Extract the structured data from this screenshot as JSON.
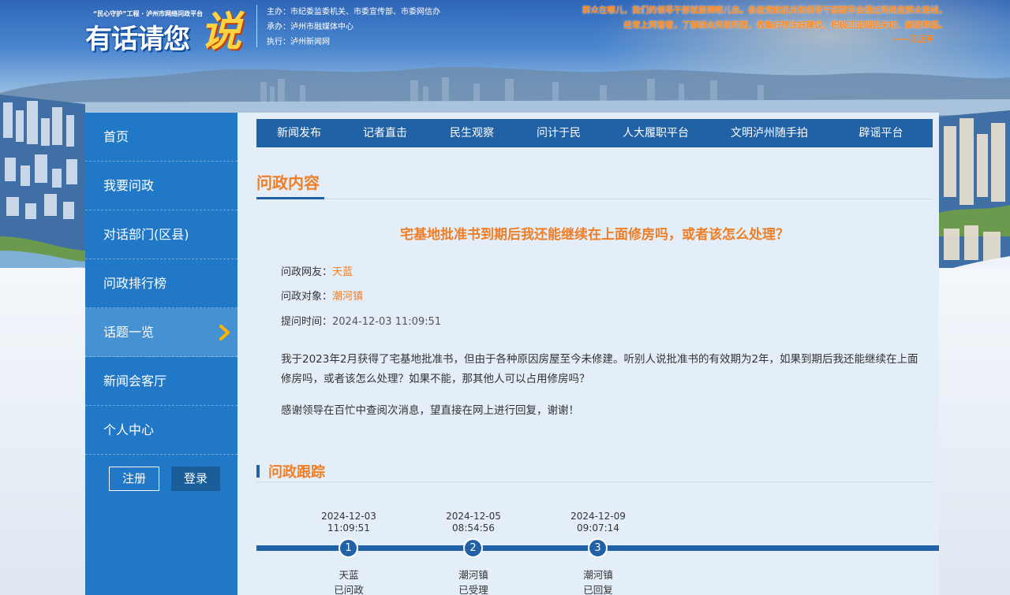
{
  "header": {
    "logo_sub": "“民心守护”工程 · 泸州市网络问政平台",
    "logo_main": "有话请您",
    "logo_accent": "说",
    "sponsor_lines": [
      "主办：市纪委监委机关、市委宣传部、市委网信办",
      "承办：泸州市融媒体中心",
      "执行：泸州新闻网"
    ],
    "quote_lines": [
      "群众在哪儿，我们的领导干部就要到哪儿去。各级党政机关和领导干部要学会通过网络走群众路线，",
      "经常上网看看，了解群众所思所愿，收集好想法好建议，积极回应网民关切、解疑释惑。"
    ],
    "quote_author": "——习近平"
  },
  "sidebar": {
    "items": [
      {
        "label": "首页"
      },
      {
        "label": "我要问政"
      },
      {
        "label": "对话部门(区县)"
      },
      {
        "label": "问政排行榜"
      },
      {
        "label": "话题一览"
      },
      {
        "label": "新闻会客厅"
      },
      {
        "label": "个人中心"
      }
    ],
    "active_index": 4,
    "register_label": "注册",
    "login_label": "登录"
  },
  "topnav": {
    "items": [
      "新闻发布",
      "记者直击",
      "民生观察",
      "问计于民",
      "人大履职平台",
      "文明泸州随手拍",
      "辟谣平台"
    ]
  },
  "content": {
    "section_title": "问政内容",
    "question_title": "宅基地批准书到期后我还能继续在上面修房吗，或者该怎么处理？",
    "asker_label": "问政网友：",
    "asker": "天蓝",
    "target_label": "问政对象：",
    "target": "潮河镇",
    "time_label": "提问时间：",
    "time": "2024-12-03 11:09:51",
    "body": "我于2023年2月获得了宅基地批准书，但由于各种原因房屋至今未修建。听别人说批准书的有效期为2年，如果到期后我还能继续在上面修房吗，或者该怎么处理？如果不能，那其他人可以占用修房吗？",
    "thanks": "感谢领导在百忙中查阅次消息，望直接在网上进行回复，谢谢！"
  },
  "tracking": {
    "section_title": "问政跟踪",
    "steps": [
      {
        "num": "1",
        "date": "2024-12-03",
        "time": "11:09:51",
        "who": "天蓝",
        "status": "已问政"
      },
      {
        "num": "2",
        "date": "2024-12-05",
        "time": "08:54:56",
        "who": "潮河镇",
        "status": "已受理"
      },
      {
        "num": "3",
        "date": "2024-12-09",
        "time": "09:07:14",
        "who": "潮河镇",
        "status": "已回复"
      }
    ]
  },
  "colors": {
    "accent_orange": "#f07e26",
    "nav_blue": "#2161a6",
    "sidebar_blue": "#2178c7"
  }
}
